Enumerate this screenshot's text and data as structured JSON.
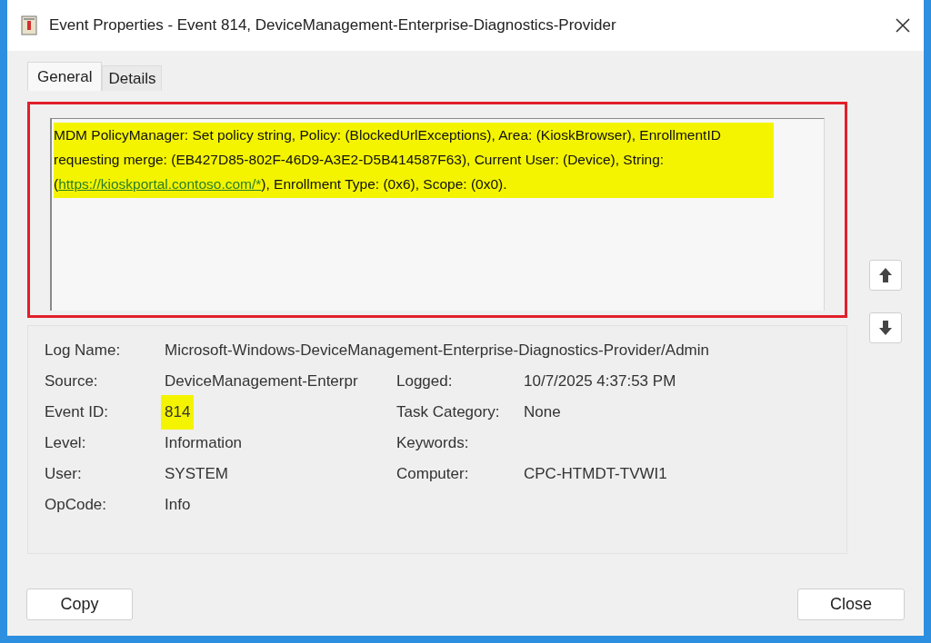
{
  "window": {
    "title": "Event Properties - Event 814, DeviceManagement-Enterprise-Diagnostics-Provider"
  },
  "tabs": [
    {
      "label": "General",
      "selected": true
    },
    {
      "label": "Details",
      "selected": false
    }
  ],
  "message": {
    "text_before": "MDM PolicyManager: Set policy string, Policy: (BlockedUrlExceptions), Area: (KioskBrowser), EnrollmentID requesting merge: (EB427D85-802F-46D9-A3E2-D5B414587F63), Current User: (Device), String: (",
    "link": "https://kioskportal.contoso.com/*",
    "text_after": "), Enrollment Type: (0x6), Scope: (0x0).",
    "highlighted": true,
    "outlined": true
  },
  "log_name": {
    "label": "Log Name:",
    "value": "Microsoft-Windows-DeviceManagement-Enterprise-Diagnostics-Provider/Admin"
  },
  "fields": [
    {
      "label": "Source:",
      "value": "DeviceManagement-Enterpr",
      "highlighted": false,
      "label_2": "Logged:",
      "value_2": "10/7/2025 4:37:53 PM"
    },
    {
      "label": "Event ID:",
      "value": "814",
      "highlighted": true,
      "label_2": "Task Category:",
      "value_2": "None"
    },
    {
      "label": "Level:",
      "value": "Information",
      "highlighted": false,
      "label_2": "Keywords:"
    },
    {
      "label": "User:",
      "value": "SYSTEM",
      "highlighted": false,
      "label_2": "Computer:",
      "value_2": "CPC-HTMDT-TVWI1"
    },
    {
      "label": "OpCode:",
      "value": "Info",
      "highlighted": false
    }
  ],
  "buttons": {
    "copy": "Copy",
    "close": "Close"
  }
}
